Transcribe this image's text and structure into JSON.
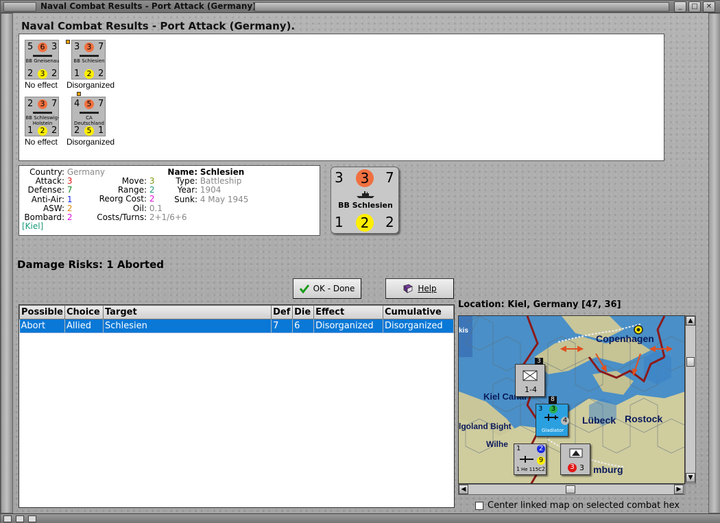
{
  "window": {
    "title": "Naval Combat Results - Port Attack (Germany)."
  },
  "heading": "Naval Combat Results - Port Attack (Germany).",
  "results": [
    {
      "name": "BB Gneisenau",
      "tl": "5",
      "tc": "6",
      "tr": "3",
      "bl": "2",
      "bc": "3",
      "br": "2",
      "effect": "No effect"
    },
    {
      "name": "BB Schlesien",
      "tl": "3",
      "tc": "3",
      "tr": "7",
      "bl": "1",
      "bc": "2",
      "br": "2",
      "effect": "Disorganized"
    },
    {
      "name": "BB Schleswig-Holstein",
      "tl": "2",
      "tc": "3",
      "tr": "7",
      "bl": "1",
      "bc": "2",
      "br": "2",
      "effect": "No effect"
    },
    {
      "name": "CA Deutschland",
      "tl": "4",
      "tc": "5",
      "tr": "7",
      "bl": "2",
      "bc": "5",
      "br": "1",
      "effect": "Disorganized"
    }
  ],
  "info": {
    "country_label": "Country:",
    "country": "Germany",
    "attack_label": "Attack:",
    "attack": "3",
    "defense_label": "Defense:",
    "defense": "7",
    "antiair_label": "Anti-Air:",
    "antiair": "1",
    "asw_label": "ASW:",
    "asw": "2",
    "bombard_label": "Bombard:",
    "bombard": "2",
    "location": "[Kiel]",
    "move_label": "Move:",
    "move": "3",
    "range_label": "Range:",
    "range": "2",
    "reorg_label": "Reorg Cost:",
    "reorg": "2",
    "oil_label": "Oil:",
    "oil": "0.1",
    "costs_label": "Costs/Turns:",
    "costs": "2+1/6+6",
    "name_label": "Name:",
    "name": "Schlesien",
    "type_label": "Type:",
    "type": "Battleship",
    "year_label": "Year:",
    "year": "1904",
    "sunk_label": "Sunk:",
    "sunk": "4 May 1945"
  },
  "big_counter": {
    "tl": "3",
    "tc": "3",
    "tr": "7",
    "name": "BB Schlesien",
    "bl": "1",
    "bc": "2",
    "br": "2"
  },
  "damage_risks": "Damage Risks: 1 Aborted",
  "buttons": {
    "ok": "OK - Done",
    "help": "Help"
  },
  "table": {
    "headers": [
      "Possible",
      "Choice",
      "Target",
      "Def",
      "Die",
      "Effect",
      "Cumulative"
    ],
    "rows": [
      [
        "Abort",
        "Allied",
        "Schlesien",
        "7",
        "6",
        "Disorganized",
        "Disorganized"
      ]
    ]
  },
  "location": "Location:  Kiel, Germany [47, 36]",
  "map": {
    "labels": {
      "copenhagen": "Copenhagen",
      "kiel": "Kiel Canal",
      "lubeck": "Lübeck",
      "rostock": "Rostock",
      "heligoland": "lgoland Bight",
      "wilhelm": "Wilhe",
      "hamburg": "mburg",
      "kis": "kis"
    },
    "counters": {
      "inf_top": "3",
      "inf_val": "1-4",
      "air_a": "3",
      "air_b": "3",
      "air_c": "4",
      "air_name": "Gladiator",
      "air_top": "8",
      "bomber_a": "1",
      "bomber_b": "2",
      "bomber_c": "9",
      "bomber_d": "1",
      "bomber_e": "2",
      "bomber_name": "He 115C",
      "hq_a": "3",
      "hq_b": "3"
    }
  },
  "center_checkbox": "Center linked map on selected combat hex"
}
